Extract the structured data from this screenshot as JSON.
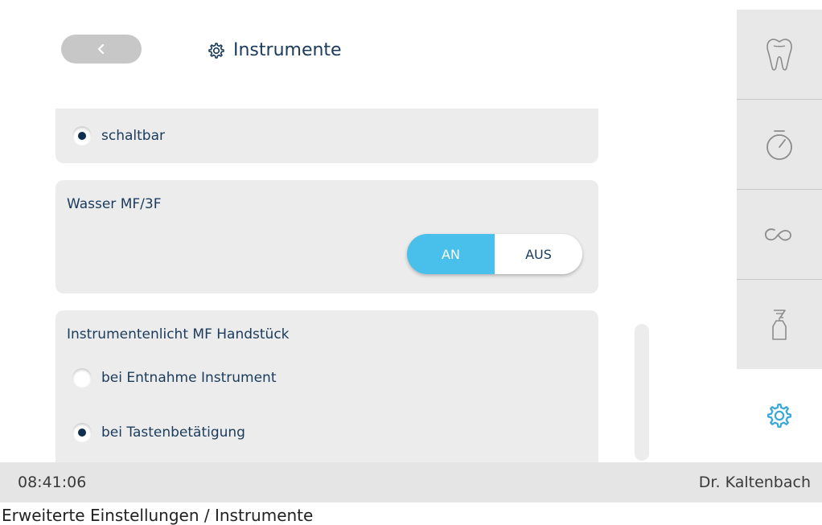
{
  "header": {
    "title": "Instrumente",
    "back_icon": "chevron-left-icon",
    "title_icon": "gear-icon"
  },
  "cards": {
    "card1": {
      "option_label": "schaltbar",
      "selected": true
    },
    "card2": {
      "title": "Wasser MF/3F",
      "on_label": "AN",
      "off_label": "AUS",
      "state": "AN"
    },
    "card3": {
      "title": "Instrumentenlicht MF Handstück",
      "options": [
        {
          "label": "bei Entnahme Instrument",
          "selected": false
        },
        {
          "label": "bei Tastenbetätigung",
          "selected": true
        }
      ]
    }
  },
  "nav": {
    "items": [
      {
        "icon": "tooth-icon",
        "active": false
      },
      {
        "icon": "stopwatch-icon",
        "active": false
      },
      {
        "icon": "tubing-icon",
        "active": false
      },
      {
        "icon": "spray-bottle-icon",
        "active": false
      },
      {
        "icon": "gear-icon",
        "active": true
      }
    ]
  },
  "status": {
    "time": "08:41:06",
    "user": "Dr. Kaltenbach"
  },
  "caption": "Erweiterte Einstellungen / Instrumente",
  "colors": {
    "accent": "#49c0ec",
    "text": "#1a3b5c",
    "card_bg": "#ececec",
    "nav_bg": "#e8e8e8",
    "status_bg": "#e5e5e5"
  }
}
